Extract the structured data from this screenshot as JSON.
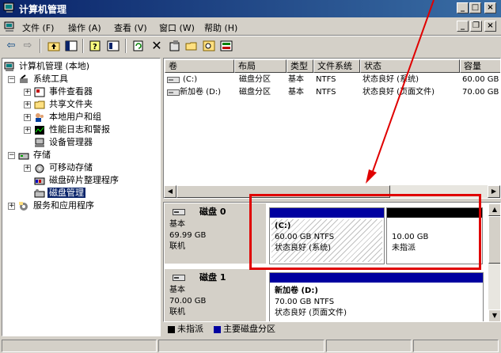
{
  "window": {
    "title": "计算机管理"
  },
  "menubar": {
    "items": [
      {
        "label": "文件 (F)"
      },
      {
        "label": "操作 (A)"
      },
      {
        "label": "查看 (V)"
      },
      {
        "label": "窗口 (W)"
      },
      {
        "label": "帮助 (H)"
      }
    ]
  },
  "toolbar": {
    "icons": [
      "back-icon",
      "forward-icon",
      "up-folder-icon",
      "show-tree-icon",
      "help-icon",
      "properties-icon",
      "refresh-icon",
      "delete-icon",
      "properties2-icon",
      "open-icon",
      "search-icon",
      "export-icon"
    ]
  },
  "tree": {
    "root": "计算机管理 (本地)",
    "system_tools": "系统工具",
    "event_viewer": "事件查看器",
    "shared_folders": "共享文件夹",
    "local_users": "本地用户和组",
    "perf_logs": "性能日志和警报",
    "device_manager": "设备管理器",
    "storage": "存储",
    "removable": "可移动存储",
    "defrag": "磁盘碎片整理程序",
    "disk_mgmt": "磁盘管理",
    "services": "服务和应用程序"
  },
  "list": {
    "headers": [
      "卷",
      "布局",
      "类型",
      "文件系统",
      "状态",
      "容量"
    ],
    "rows": [
      [
        "(C:)",
        "磁盘分区",
        "基本",
        "NTFS",
        "状态良好 (系统)",
        "60.00 GB"
      ],
      [
        "新加卷 (D:)",
        "磁盘分区",
        "基本",
        "NTFS",
        "状态良好 (页面文件)",
        "70.00 GB"
      ]
    ]
  },
  "disks": [
    {
      "name": "磁盘 0",
      "type": "基本",
      "size": "69.99 GB",
      "status": "联机",
      "partitions": [
        {
          "title": "(C:)",
          "line1": "60.00 GB NTFS",
          "line2": "状态良好 (系统)"
        },
        {
          "title": "",
          "line1": "10.00 GB",
          "line2": "未指派"
        }
      ]
    },
    {
      "name": "磁盘 1",
      "type": "基本",
      "size": "70.00 GB",
      "status": "联机",
      "partitions": [
        {
          "title": "新加卷 (D:)",
          "line1": "70.00 GB NTFS",
          "line2": "状态良好 (页面文件)"
        }
      ]
    }
  ],
  "legend": {
    "unallocated": "未指派",
    "primary": "主要磁盘分区"
  },
  "colors": {
    "primary": "#0000a0",
    "unallocated": "#000000",
    "selection": "#0a246a",
    "annotation": "#e00000"
  }
}
